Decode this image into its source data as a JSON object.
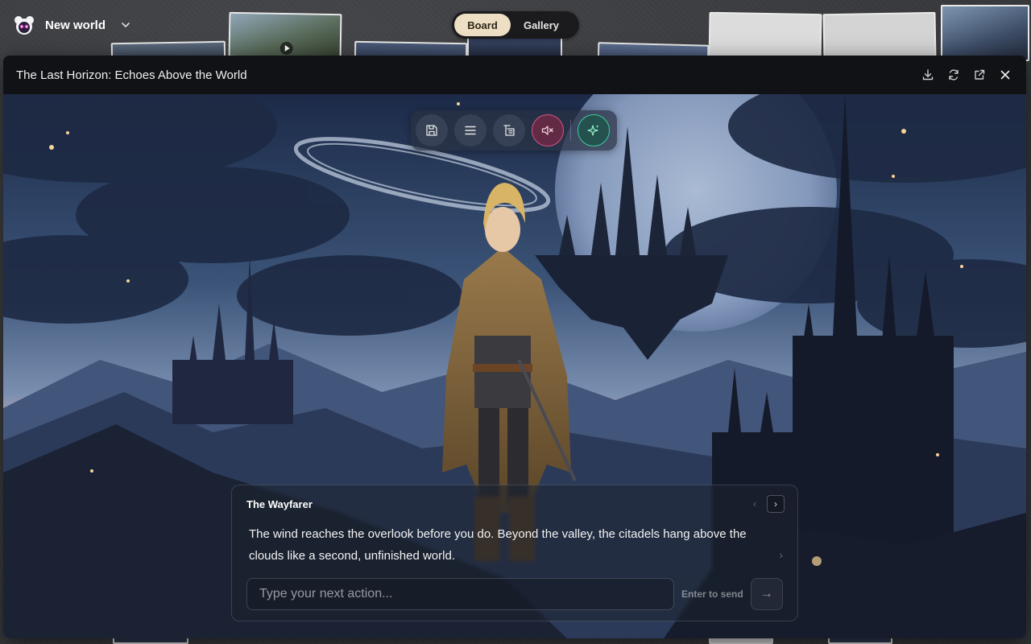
{
  "app": {
    "project_name": "New world",
    "view_toggle": {
      "board_label": "Board",
      "gallery_label": "Gallery",
      "active": "Board"
    }
  },
  "modal": {
    "title": "The Last Horizon: Echoes Above the World",
    "actions": [
      "download-icon",
      "refresh-icon",
      "external-link-icon",
      "close-icon"
    ]
  },
  "toolbar": {
    "buttons": [
      "save-icon",
      "menu-icon",
      "history-icon",
      "mute-icon",
      "sparkle-icon"
    ]
  },
  "dialog": {
    "speaker": "The Wayfarer",
    "text": "The wind reaches the overlook before you do. Beyond the valley, the citadels hang above the clouds like a second, unfinished world.",
    "prev_symbol": "‹",
    "next_symbol": "›",
    "input_placeholder": "Type your next action...",
    "input_value": "",
    "enter_hint": "Enter to send",
    "send_symbol": "→"
  },
  "colors": {
    "toggle_active_bg": "#eedfc4",
    "mute_accent": "#d35485",
    "magic_accent": "#3fc99a",
    "modal_bg": "#101114"
  }
}
